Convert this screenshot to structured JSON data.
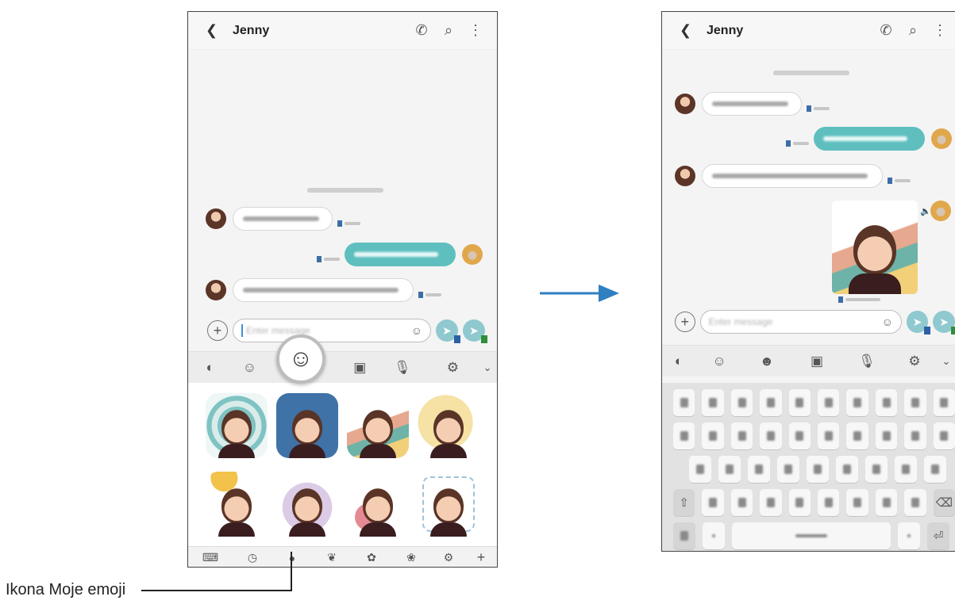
{
  "left_phone": {
    "contact_name": "Jenny",
    "icons": {
      "back": "chevron-left-icon",
      "call": "phone-icon",
      "search": "search-icon",
      "more": "more-vertical-icon"
    },
    "toolbar_icons": [
      "bixby-icon",
      "emoji-icon",
      "sticker-icon",
      "gif-icon",
      "mic-icon",
      "settings-icon",
      "chevron-down-icon"
    ],
    "bottom_icons": [
      "keyboard-icon",
      "recent-icon",
      "my-emoji-icon",
      "animal-sticker-icon",
      "sticker-pack-icon",
      "sticker-pack-icon",
      "settings-icon",
      "add-icon"
    ]
  },
  "right_phone": {
    "contact_name": "Jenny",
    "icons": {
      "back": "chevron-left-icon",
      "call": "phone-icon",
      "search": "search-icon",
      "more": "more-vertical-icon"
    },
    "keys": {
      "shift": "⇧",
      "backspace": "⌫",
      "enter": "⏎"
    }
  },
  "callout": {
    "label": "Ikona Moje emoji"
  },
  "colors": {
    "bubble_out": "#5fbfbf",
    "arrow": "#2f7fc1",
    "sim1": "#2c61a5",
    "sim2": "#2f8f3c"
  }
}
